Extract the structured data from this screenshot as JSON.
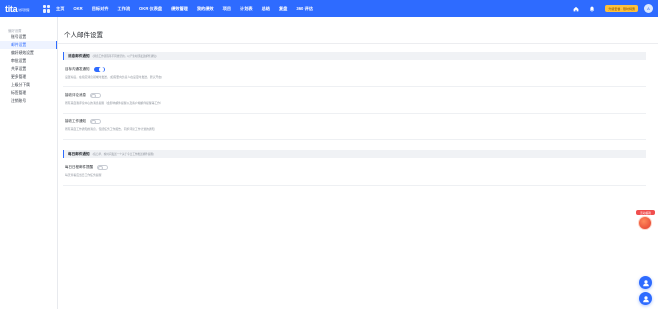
{
  "app": {
    "logo_text": "tita",
    "logo_sub": "协同管理",
    "avatar_initial": "A"
  },
  "nav": [
    "主页",
    "OKR",
    "目标对齐",
    "工作流",
    "OKR 仪表盘",
    "绩效管理",
    "我的绩效",
    "项目",
    "计划表",
    "总结",
    "复盘",
    "360 评估"
  ],
  "top_right": {
    "trial_badge": "升级套餐 · 限时特惠",
    "icons": [
      "home-icon",
      "bell-icon"
    ]
  },
  "sidebar": {
    "title": "偏好设置",
    "items": [
      "账号设置",
      "邮件设置",
      "偏好绩效设置",
      "审批设置",
      "共享设置",
      "更多管理",
      "上级分下属",
      "标签管理",
      "注销账号"
    ],
    "active_index": 1
  },
  "page": {
    "title": "个人邮件设置"
  },
  "sections": [
    {
      "title": "消息邮件通知",
      "hint": "(消息工作流程等不同类型的，以产生时即发送邮件通知)",
      "settings": [
        {
          "label": "目标沟通发通知",
          "desc": "设置好后，在指定消息领域时发送，(如需要向负责人在设定时发送，默认开启)",
          "enabled": true
        },
        {
          "label": "接收评论消息",
          "desc": "所有来自我评论中心的消息提醒（会影响邮件提醒以及客户端邮件提醒等工作）",
          "enabled": false
        },
        {
          "label": "接收工作通知",
          "desc": "所有来自工作通知的消息，包括任务工作报告，同步评论工作计划的通知",
          "enabled": false
        }
      ]
    },
    {
      "title": "每日邮件通知",
      "hint": "(每日早、晚时间发送一个关于今日工作推送邮件提醒)",
      "settings": [
        {
          "label": "每日日程邮件提醒",
          "desc": "每天查看应当日工作任务提醒",
          "enabled": false
        }
      ]
    }
  ],
  "floating": {
    "gift_label": "活动福利"
  },
  "colors": {
    "accent": "#2e6bff",
    "gift": "#f04e4e"
  }
}
